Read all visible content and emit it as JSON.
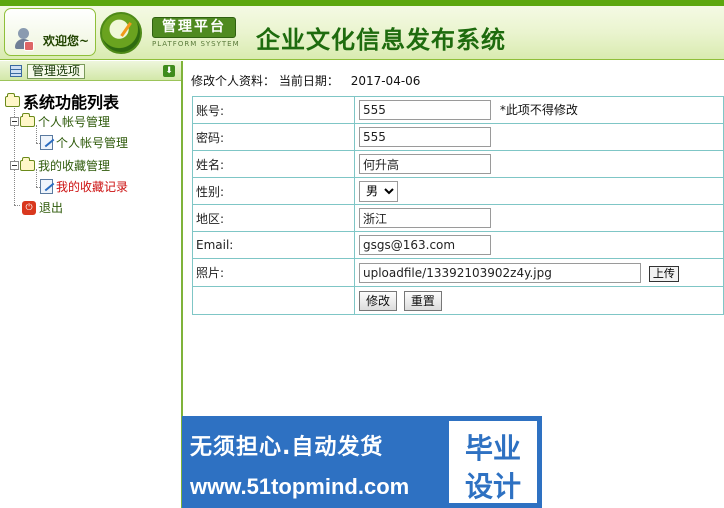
{
  "header": {
    "welcome": "欢迎您~",
    "logo_main": "管理平台",
    "logo_sub": "PLATFORM SYSYTEM",
    "system_title": "企业文化信息发布系统"
  },
  "sidebar": {
    "button_label": "管理选项",
    "root_label": "系统功能列表",
    "groups": [
      {
        "label": "个人帐号管理",
        "children": [
          {
            "label": "个人帐号管理"
          }
        ]
      },
      {
        "label": "我的收藏管理",
        "children": [
          {
            "label": "我的收藏记录"
          }
        ]
      }
    ],
    "exit_label": "退出"
  },
  "main": {
    "heading": "修改个人资料：",
    "date_label": "当前日期：",
    "date_value": "2017-04-06",
    "form": {
      "account_label": "账号:",
      "account_value": "555",
      "account_note": "*此项不得修改",
      "password_label": "密码:",
      "password_value": "555",
      "name_label": "姓名:",
      "name_value": "何升高",
      "gender_label": "性别:",
      "gender_value": "男",
      "region_label": "地区:",
      "region_value": "浙江",
      "email_label": "Email:",
      "email_value": "gsgs@163.com",
      "photo_label": "照片:",
      "photo_value": "uploadfile/13392103902z4y.jpg",
      "upload_label": "上传",
      "submit_label": "修改",
      "reset_label": "重置"
    }
  },
  "watermark": {
    "line1": "无须担心.自动发货",
    "line2": "www.51topmind.com",
    "box_line1": "毕业",
    "box_line2": "设计"
  }
}
